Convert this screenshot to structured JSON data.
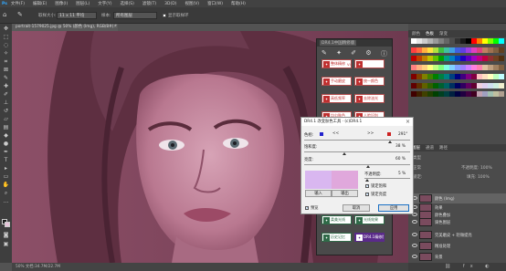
{
  "menu": [
    "文件(F)",
    "编辑(E)",
    "图像(I)",
    "图层(L)",
    "文字(Y)",
    "选择(S)",
    "滤镜(T)",
    "3D(D)",
    "视图(V)",
    "窗口(W)",
    "帮助(H)"
  ],
  "options": {
    "size_label": "取样大小:",
    "size_value": "11 x 11 平均",
    "sample_label": "样本:",
    "sample_value": "所有图层",
    "show_ring": "显示取样环"
  },
  "document": {
    "tab": "portrait-1579025.jpg @ 50% (颜色 (Img), RGB/8#) *",
    "status": "50%   文档:34.7M/22.7M"
  },
  "dr4": {
    "tab": "DR4.1中国精修版",
    "rows": [
      [
        {
          "label": "整体精修",
          "badge": "V4.5",
          "style": "red"
        },
        {
          "label": "",
          "style": "red"
        }
      ],
      [
        {
          "label": "手动磨皮",
          "style": "red"
        },
        {
          "label": "统一颜色",
          "style": "red"
        }
      ],
      [
        {
          "label": "高低频率",
          "style": "red"
        },
        {
          "label": "去除油光",
          "style": "red"
        }
      ],
      [
        {
          "label": "均匀肤色",
          "style": "red"
        },
        {
          "label": "人脸识别",
          "style": "red"
        }
      ],
      [
        {
          "label": "磨皮修复",
          "style": "red"
        },
        {
          "label": "",
          "style": "red"
        }
      ],
      [
        {
          "label": "锐化增强",
          "style": "green"
        },
        {
          "label": "高清修复",
          "style": "green"
        }
      ],
      [
        {
          "label": "智能增强",
          "style": "green"
        },
        {
          "label": "智能液化",
          "style": "green"
        }
      ],
      [
        {
          "label": "积极修色",
          "style": "green"
        },
        {
          "label": "梦幻效果",
          "style": "green"
        }
      ],
      [
        {
          "label": "精致美白",
          "style": "green"
        },
        {
          "label": "暖调调色",
          "style": "green"
        }
      ],
      [
        {
          "label": "柔美光线",
          "style": "green"
        },
        {
          "label": "光线效果",
          "style": "green"
        }
      ],
      [
        {
          "label": "历史记忆",
          "style": "green"
        },
        {
          "label": "DR4.1精修版",
          "style": "sel"
        }
      ]
    ]
  },
  "dialog": {
    "title": "DR4.1 改变肤色工具 · (c)DR4.1",
    "hue_label": "色相:",
    "hue_value": "291°",
    "sat_label": "饱和度:",
    "sat_value": "38 %",
    "light_label": "亮度:",
    "light_value": "60 %",
    "opacity_label": "不透明度:",
    "opacity_value": "5 %",
    "input_label": "输入",
    "output_label": "输出",
    "lock_sat": "锁定饱和",
    "lock_light": "锁定亮度",
    "preview": "预览",
    "cancel": "取消",
    "ok": "应用",
    "hue": 291,
    "saturation": 38,
    "lightness": 60,
    "opacity": 5,
    "colors": {
      "input": "#d9b7f0",
      "output": "#e0a8dc",
      "accent": "#1a6fc4",
      "hue_marker": "#2222cc",
      "end_marker": "#cc2222"
    }
  },
  "panels": {
    "color_tabs": [
      "颜色",
      "色板",
      "渐变"
    ],
    "layer_tabs": [
      "图层",
      "通道",
      "路径"
    ],
    "kind_label": "类型",
    "mode_label": "正常",
    "opacity_label": "不透明度: 100%",
    "fill_label": "填充: 100%",
    "lock_label": "锁定:",
    "layers": [
      {
        "name": "颜色 (Img)",
        "selected": true
      },
      {
        "name": "效果",
        "selected": false
      },
      {
        "name": "颜色叠加",
        "selected": false
      },
      {
        "name": "调色图层",
        "selected": false
      },
      {
        "name": "完美磨皮 + 轻微提亮",
        "selected": false
      },
      {
        "name": "精准处理",
        "selected": false
      },
      {
        "name": "背景",
        "selected": false
      }
    ]
  },
  "swatches": [
    "#ffffff",
    "#e6e6e6",
    "#cccccc",
    "#b3b3b3",
    "#999999",
    "#808080",
    "#666666",
    "#4d4d4d",
    "#333333",
    "#1a1a1a",
    "#000000",
    "#ff0000",
    "#ff8000",
    "#ffff00",
    "#80ff00",
    "#00ff00",
    "#00ffff",
    "#ff4040",
    "#ff6a40",
    "#ffb040",
    "#ffe040",
    "#b0e040",
    "#40c040",
    "#40c0a0",
    "#40a0e0",
    "#4060e0",
    "#6040e0",
    "#a040e0",
    "#e040c0",
    "#e04080",
    "#c08060",
    "#a07050",
    "#806040",
    "#604020",
    "#c00000",
    "#c04000",
    "#c08000",
    "#c0c000",
    "#60c000",
    "#00a000",
    "#00a080",
    "#0080c0",
    "#0040c0",
    "#2000c0",
    "#6000c0",
    "#a000c0",
    "#c00080",
    "#c00040",
    "#903030",
    "#704020",
    "#503010",
    "#ff8080",
    "#ffb080",
    "#ffd080",
    "#ffff80",
    "#c0ff80",
    "#80ff80",
    "#80ffe0",
    "#80d0ff",
    "#80a0ff",
    "#a080ff",
    "#d080ff",
    "#ff80e0",
    "#ff80b0",
    "#e0c0a0",
    "#c0a080",
    "#a08060",
    "#806040",
    "#800000",
    "#804000",
    "#808000",
    "#408000",
    "#008000",
    "#008040",
    "#008080",
    "#004080",
    "#000080",
    "#400080",
    "#800080",
    "#800040",
    "#ffc0c0",
    "#ffe0c0",
    "#ffffc0",
    "#c0ffc0",
    "#c0ffff",
    "#600000",
    "#603000",
    "#606000",
    "#306000",
    "#006000",
    "#006030",
    "#006060",
    "#003060",
    "#000060",
    "#300060",
    "#600060",
    "#600030",
    "#f0d0e0",
    "#e0d0f0",
    "#d0e0f0",
    "#d0f0e0",
    "#f0f0d0",
    "#400000",
    "#402000",
    "#404000",
    "#204000",
    "#004000",
    "#004020",
    "#004040",
    "#002040",
    "#000040",
    "#200040",
    "#400040",
    "#400020",
    "#c0a0b0",
    "#a0a0c0",
    "#a0c0b0",
    "#c0c0a0",
    "#b0a090"
  ],
  "canvas_colors": {
    "bg": "#8a4a64",
    "skin": "#c58aa0",
    "hair": "#5a2c3c"
  }
}
